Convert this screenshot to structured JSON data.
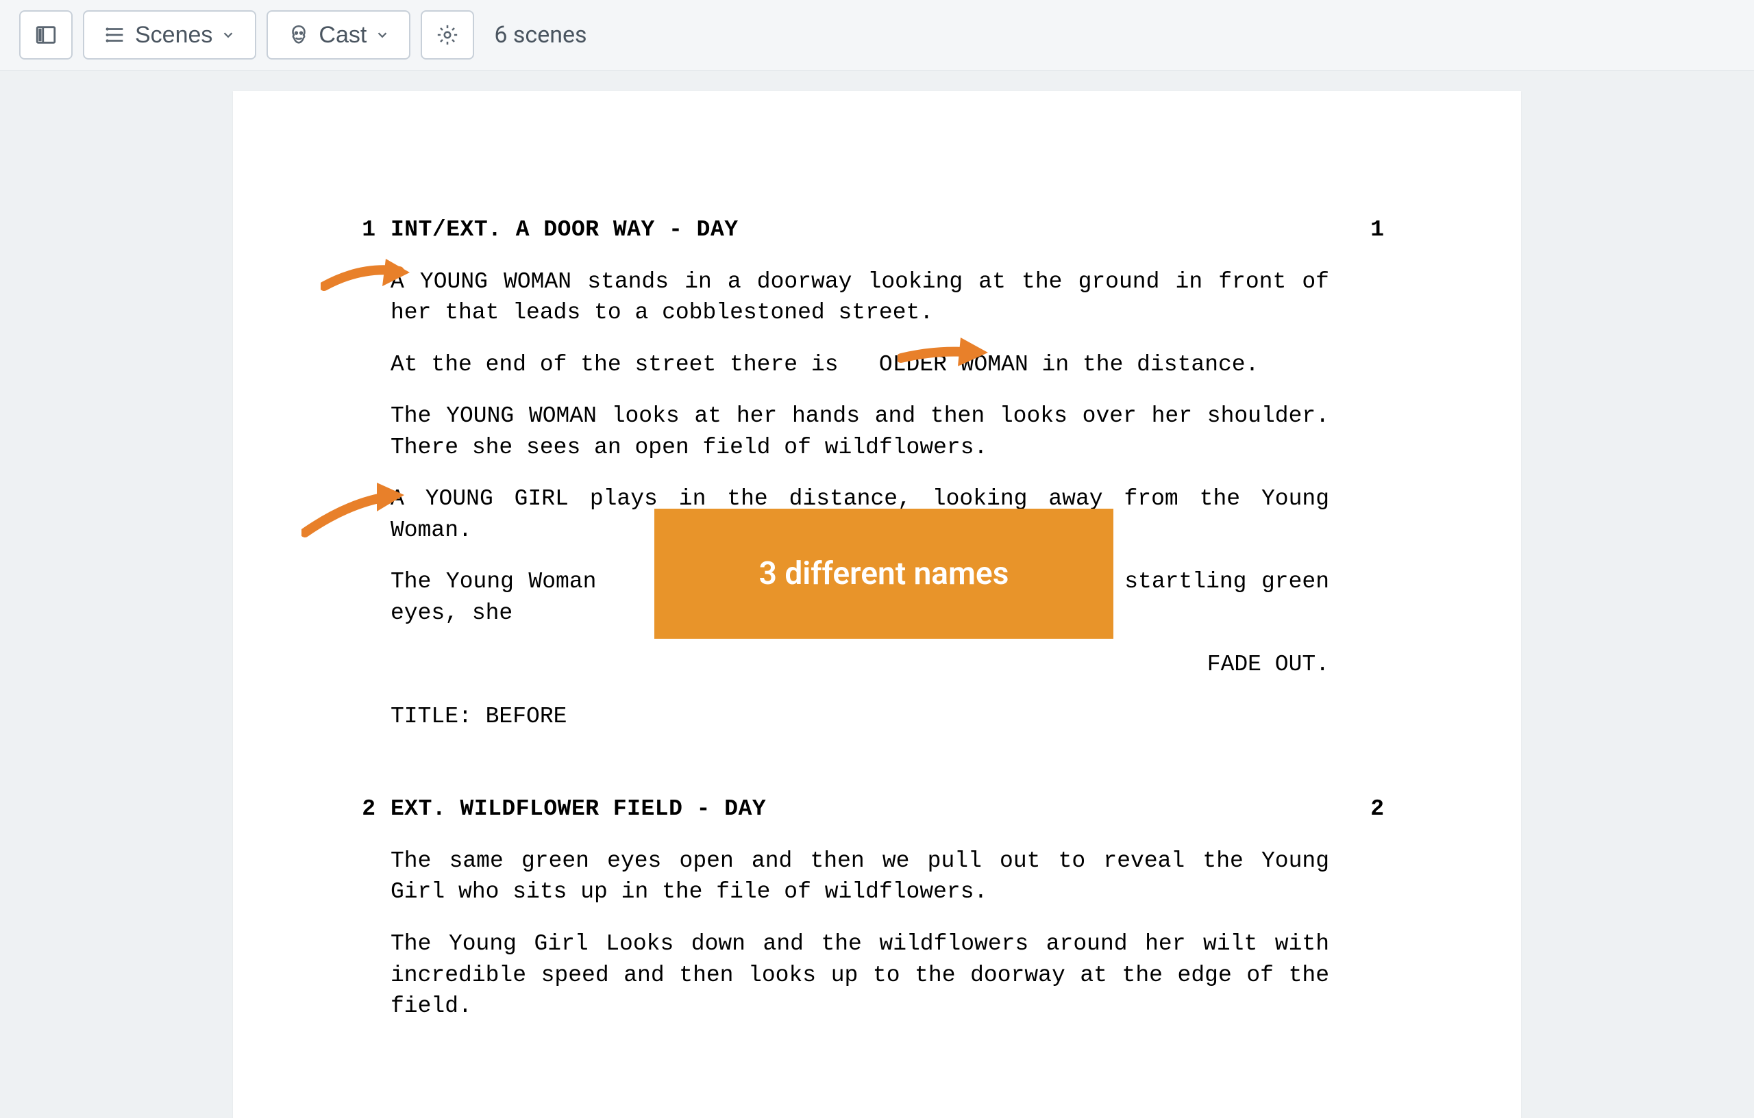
{
  "toolbar": {
    "scenes_label": "Scenes",
    "cast_label": "Cast",
    "scene_count_label": "6 scenes"
  },
  "scenes": [
    {
      "num": "1",
      "heading": "INT/EXT. A DOOR WAY - DAY",
      "actions": [
        "A YOUNG WOMAN stands in a doorway looking at the ground in front of her that leads to a cobblestoned street.",
        "At the end of the street there is   OLDER WOMAN in the distance.",
        "The YOUNG WOMAN looks at her hands and then looks over her shoulder. There she sees an open field of wildflowers.",
        "A YOUNG GIRL plays in the distance, looking away from the Young Woman.",
        "The Young Woman                                 on startling green eyes, she"
      ],
      "transition": "FADE OUT.",
      "title": "TITLE: BEFORE"
    },
    {
      "num": "2",
      "heading": "EXT. WILDFLOWER FIELD - DAY",
      "actions": [
        "The same green eyes open and then we pull out to reveal the Young Girl who sits up in the file of wildflowers.",
        "The Young Girl Looks down and the wildflowers around her wilt with incredible speed and then looks up to the doorway at the edge of the field."
      ]
    }
  ],
  "annotations": {
    "callout_text": "3 different names",
    "callout_color": "#e8942a"
  }
}
